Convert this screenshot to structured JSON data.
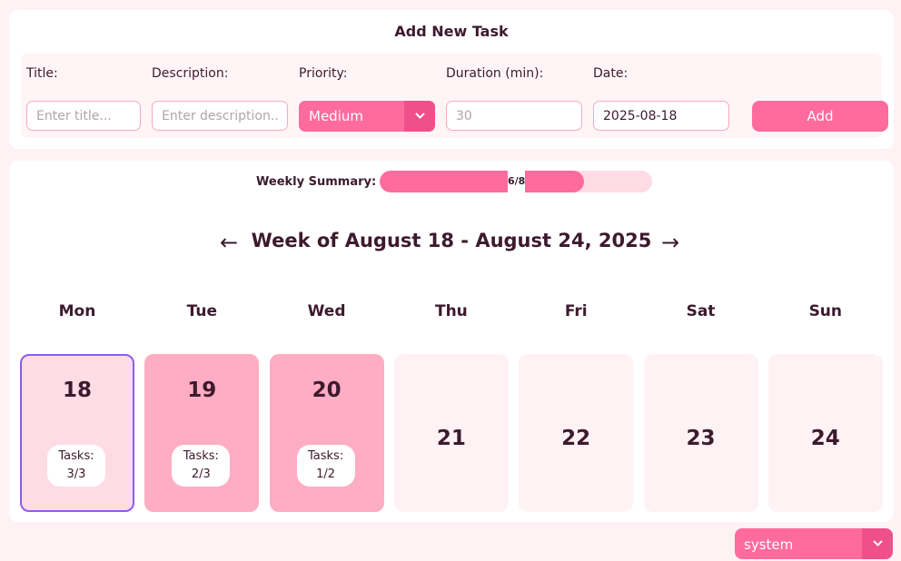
{
  "form": {
    "title": "Add New Task",
    "labels": {
      "title": "Title:",
      "description": "Description:",
      "priority": "Priority:",
      "duration": "Duration (min):",
      "date": "Date:"
    },
    "title_placeholder": "Enter title...",
    "description_placeholder": "Enter description...",
    "priority_value": "Medium",
    "duration_placeholder": "30",
    "date_value": "2025-08-18",
    "add_label": "Add"
  },
  "summary": {
    "label": "Weekly Summary:",
    "text": "6/8",
    "completed": 6,
    "total": 8
  },
  "week": {
    "prev": "←",
    "next": "→",
    "title": "Week of August 18 - August 24, 2025"
  },
  "days": [
    {
      "name": "Mon",
      "num": "18",
      "tasks_label": "Tasks:",
      "tasks_value": "3/3"
    },
    {
      "name": "Tue",
      "num": "19",
      "tasks_label": "Tasks:",
      "tasks_value": "2/3"
    },
    {
      "name": "Wed",
      "num": "20",
      "tasks_label": "Tasks:",
      "tasks_value": "1/2"
    },
    {
      "name": "Thu",
      "num": "21"
    },
    {
      "name": "Fri",
      "num": "22"
    },
    {
      "name": "Sat",
      "num": "23"
    },
    {
      "name": "Sun",
      "num": "24"
    }
  ],
  "theme": {
    "value": "system"
  },
  "icons": {
    "select_arrow": "chevron-down-icon",
    "prev": "arrow-left-icon",
    "next": "arrow-right-icon"
  },
  "colors": {
    "accent": "#ff6b9d",
    "accent_dark": "#f0508a",
    "today_border": "#8b5cf6",
    "today_bg": "#ffdce5",
    "busy_bg": "#ffadc4",
    "empty_bg": "#fff2f4",
    "text": "#3d1a2e"
  }
}
